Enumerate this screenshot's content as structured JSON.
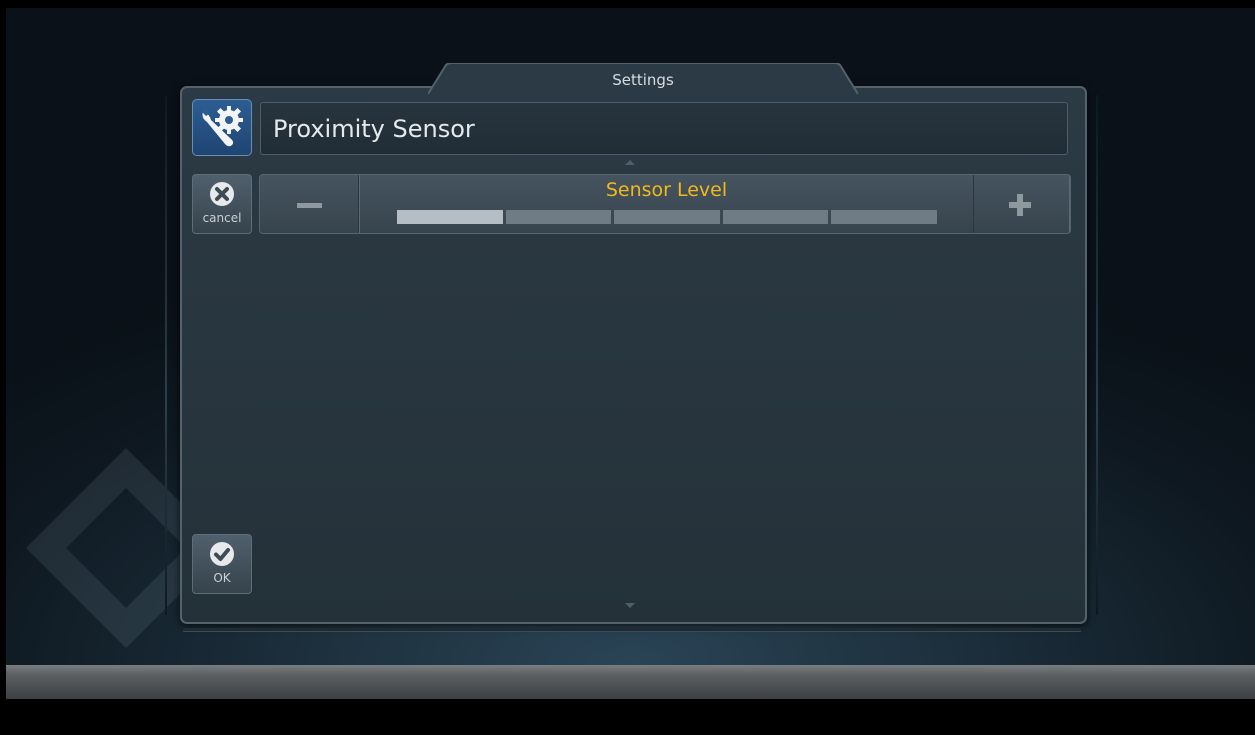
{
  "dialog": {
    "title": "Settings"
  },
  "setting": {
    "icon": "wrench-gear-icon",
    "name": "Proximity Sensor"
  },
  "cancel": {
    "icon": "x-circle-icon",
    "label": "cancel"
  },
  "ok": {
    "icon": "check-circle-icon",
    "label": "OK"
  },
  "sensor_level": {
    "label": "Sensor Level",
    "current_level": 1,
    "max_level": 5,
    "decrease_icon": "minus-icon",
    "increase_icon": "plus-icon"
  },
  "colors": {
    "accent": "#f2b81c",
    "icon_bg": "#2c5d93",
    "segment_on": "#b5bec4",
    "segment_off": "#6f7c86"
  }
}
